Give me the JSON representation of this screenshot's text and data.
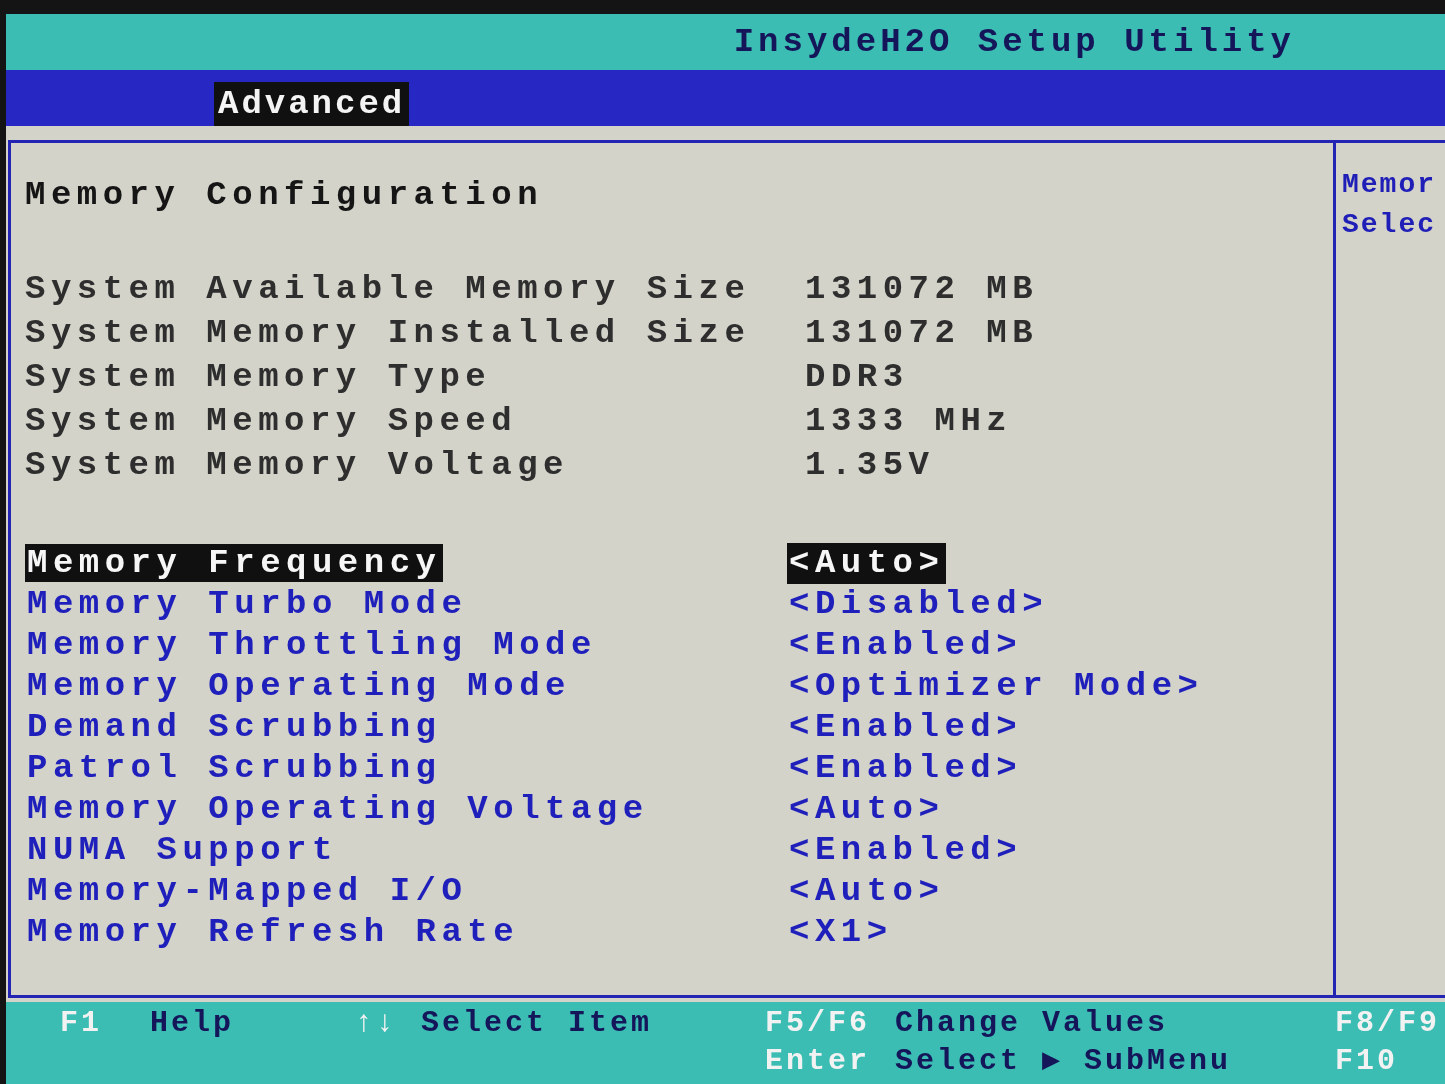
{
  "header": {
    "title": "InsydeH2O Setup Utility",
    "tabs": [
      {
        "label": "Advanced",
        "selected": true
      }
    ]
  },
  "page": {
    "heading": "Memory Configuration",
    "info": [
      {
        "label": "System Available Memory Size",
        "value": "131072 MB"
      },
      {
        "label": "System Memory Installed Size",
        "value": "131072 MB"
      },
      {
        "label": "System Memory Type",
        "value": "DDR3"
      },
      {
        "label": "System Memory Speed",
        "value": "1333 MHz"
      },
      {
        "label": "System Memory Voltage",
        "value": "1.35V"
      }
    ],
    "settings": [
      {
        "label": "Memory Frequency",
        "value": "<Auto>",
        "selected": true
      },
      {
        "label": "Memory Turbo Mode",
        "value": "<Disabled>",
        "selected": false
      },
      {
        "label": "Memory Throttling Mode",
        "value": "<Enabled>",
        "selected": false
      },
      {
        "label": "Memory Operating Mode",
        "value": "<Optimizer Mode>",
        "selected": false
      },
      {
        "label": "Demand Scrubbing",
        "value": "<Enabled>",
        "selected": false
      },
      {
        "label": "Patrol Scrubbing",
        "value": "<Enabled>",
        "selected": false
      },
      {
        "label": "Memory Operating Voltage",
        "value": "<Auto>",
        "selected": false
      },
      {
        "label": "NUMA Support",
        "value": "<Enabled>",
        "selected": false
      },
      {
        "label": "Memory-Mapped I/O",
        "value": "<Auto>",
        "selected": false
      },
      {
        "label": "Memory Refresh Rate",
        "value": "<X1>",
        "selected": false
      }
    ]
  },
  "help_panel": {
    "lines": [
      "Memor",
      "Selec"
    ]
  },
  "key_legend": {
    "columns": [
      [
        {
          "key": "F1",
          "action": "Help"
        }
      ],
      [
        {
          "key": "↑↓",
          "action": "Select Item"
        }
      ],
      [
        {
          "key": "F5/F6",
          "action": "Change Values"
        },
        {
          "key": "Enter",
          "action": "Select ▶ SubMenu"
        }
      ],
      [
        {
          "key": "F8/F9"
        },
        {
          "key": "F10"
        }
      ]
    ]
  }
}
